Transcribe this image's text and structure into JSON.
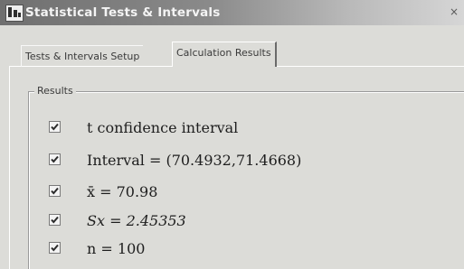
{
  "window": {
    "title": "Statistical Tests & Intervals",
    "close_glyph": "×"
  },
  "tabs": [
    {
      "label": "Tests & Intervals Setup",
      "active": false
    },
    {
      "label": "Calculation Results",
      "active": true
    }
  ],
  "results": {
    "group_title": "Results",
    "rows": [
      {
        "checked": true,
        "text": "t confidence interval"
      },
      {
        "checked": true,
        "text": "Interval = (70.4932,71.4668)"
      },
      {
        "checked": true,
        "text": "x̄ = 70.98"
      },
      {
        "checked": true,
        "text": "Sx = 2.45353"
      },
      {
        "checked": true,
        "text": "n = 100"
      }
    ]
  },
  "icons": {
    "app": "stats-app-icon",
    "close": "close-icon",
    "check": "checkmark-icon"
  },
  "colors": {
    "titlebar_start": "#6f6f6f",
    "titlebar_end": "#d6d6d6",
    "dialog_bg": "#dcdcd8",
    "text": "#1e1e1e"
  }
}
